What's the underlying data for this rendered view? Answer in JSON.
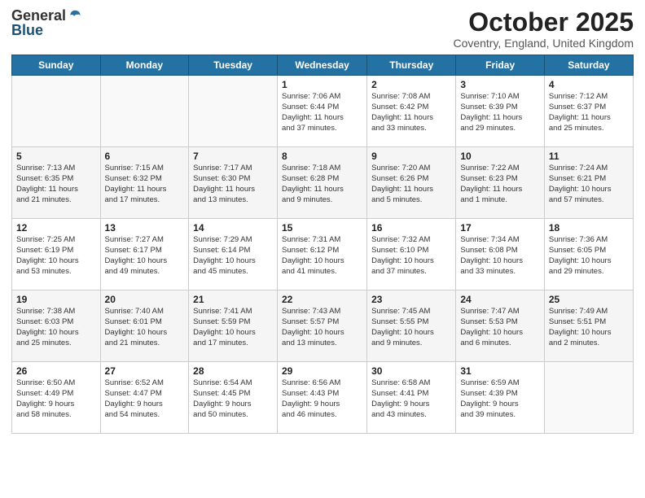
{
  "logo": {
    "general": "General",
    "blue": "Blue"
  },
  "title": "October 2025",
  "location": "Coventry, England, United Kingdom",
  "days_of_week": [
    "Sunday",
    "Monday",
    "Tuesday",
    "Wednesday",
    "Thursday",
    "Friday",
    "Saturday"
  ],
  "weeks": [
    [
      {
        "day": "",
        "info": ""
      },
      {
        "day": "",
        "info": ""
      },
      {
        "day": "",
        "info": ""
      },
      {
        "day": "1",
        "info": "Sunrise: 7:06 AM\nSunset: 6:44 PM\nDaylight: 11 hours\nand 37 minutes."
      },
      {
        "day": "2",
        "info": "Sunrise: 7:08 AM\nSunset: 6:42 PM\nDaylight: 11 hours\nand 33 minutes."
      },
      {
        "day": "3",
        "info": "Sunrise: 7:10 AM\nSunset: 6:39 PM\nDaylight: 11 hours\nand 29 minutes."
      },
      {
        "day": "4",
        "info": "Sunrise: 7:12 AM\nSunset: 6:37 PM\nDaylight: 11 hours\nand 25 minutes."
      }
    ],
    [
      {
        "day": "5",
        "info": "Sunrise: 7:13 AM\nSunset: 6:35 PM\nDaylight: 11 hours\nand 21 minutes."
      },
      {
        "day": "6",
        "info": "Sunrise: 7:15 AM\nSunset: 6:32 PM\nDaylight: 11 hours\nand 17 minutes."
      },
      {
        "day": "7",
        "info": "Sunrise: 7:17 AM\nSunset: 6:30 PM\nDaylight: 11 hours\nand 13 minutes."
      },
      {
        "day": "8",
        "info": "Sunrise: 7:18 AM\nSunset: 6:28 PM\nDaylight: 11 hours\nand 9 minutes."
      },
      {
        "day": "9",
        "info": "Sunrise: 7:20 AM\nSunset: 6:26 PM\nDaylight: 11 hours\nand 5 minutes."
      },
      {
        "day": "10",
        "info": "Sunrise: 7:22 AM\nSunset: 6:23 PM\nDaylight: 11 hours\nand 1 minute."
      },
      {
        "day": "11",
        "info": "Sunrise: 7:24 AM\nSunset: 6:21 PM\nDaylight: 10 hours\nand 57 minutes."
      }
    ],
    [
      {
        "day": "12",
        "info": "Sunrise: 7:25 AM\nSunset: 6:19 PM\nDaylight: 10 hours\nand 53 minutes."
      },
      {
        "day": "13",
        "info": "Sunrise: 7:27 AM\nSunset: 6:17 PM\nDaylight: 10 hours\nand 49 minutes."
      },
      {
        "day": "14",
        "info": "Sunrise: 7:29 AM\nSunset: 6:14 PM\nDaylight: 10 hours\nand 45 minutes."
      },
      {
        "day": "15",
        "info": "Sunrise: 7:31 AM\nSunset: 6:12 PM\nDaylight: 10 hours\nand 41 minutes."
      },
      {
        "day": "16",
        "info": "Sunrise: 7:32 AM\nSunset: 6:10 PM\nDaylight: 10 hours\nand 37 minutes."
      },
      {
        "day": "17",
        "info": "Sunrise: 7:34 AM\nSunset: 6:08 PM\nDaylight: 10 hours\nand 33 minutes."
      },
      {
        "day": "18",
        "info": "Sunrise: 7:36 AM\nSunset: 6:05 PM\nDaylight: 10 hours\nand 29 minutes."
      }
    ],
    [
      {
        "day": "19",
        "info": "Sunrise: 7:38 AM\nSunset: 6:03 PM\nDaylight: 10 hours\nand 25 minutes."
      },
      {
        "day": "20",
        "info": "Sunrise: 7:40 AM\nSunset: 6:01 PM\nDaylight: 10 hours\nand 21 minutes."
      },
      {
        "day": "21",
        "info": "Sunrise: 7:41 AM\nSunset: 5:59 PM\nDaylight: 10 hours\nand 17 minutes."
      },
      {
        "day": "22",
        "info": "Sunrise: 7:43 AM\nSunset: 5:57 PM\nDaylight: 10 hours\nand 13 minutes."
      },
      {
        "day": "23",
        "info": "Sunrise: 7:45 AM\nSunset: 5:55 PM\nDaylight: 10 hours\nand 9 minutes."
      },
      {
        "day": "24",
        "info": "Sunrise: 7:47 AM\nSunset: 5:53 PM\nDaylight: 10 hours\nand 6 minutes."
      },
      {
        "day": "25",
        "info": "Sunrise: 7:49 AM\nSunset: 5:51 PM\nDaylight: 10 hours\nand 2 minutes."
      }
    ],
    [
      {
        "day": "26",
        "info": "Sunrise: 6:50 AM\nSunset: 4:49 PM\nDaylight: 9 hours\nand 58 minutes."
      },
      {
        "day": "27",
        "info": "Sunrise: 6:52 AM\nSunset: 4:47 PM\nDaylight: 9 hours\nand 54 minutes."
      },
      {
        "day": "28",
        "info": "Sunrise: 6:54 AM\nSunset: 4:45 PM\nDaylight: 9 hours\nand 50 minutes."
      },
      {
        "day": "29",
        "info": "Sunrise: 6:56 AM\nSunset: 4:43 PM\nDaylight: 9 hours\nand 46 minutes."
      },
      {
        "day": "30",
        "info": "Sunrise: 6:58 AM\nSunset: 4:41 PM\nDaylight: 9 hours\nand 43 minutes."
      },
      {
        "day": "31",
        "info": "Sunrise: 6:59 AM\nSunset: 4:39 PM\nDaylight: 9 hours\nand 39 minutes."
      },
      {
        "day": "",
        "info": ""
      }
    ]
  ]
}
